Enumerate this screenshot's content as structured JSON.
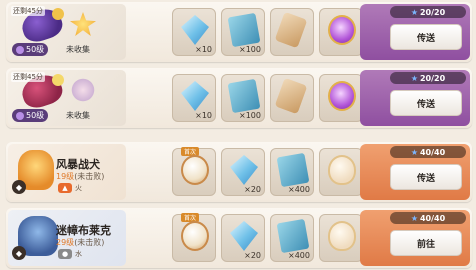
{
  "rows": [
    {
      "timer": "还剩45分",
      "level": "50级",
      "status": "未收集",
      "items": [
        {
          "icon": "diamond-icon",
          "qty": "×10"
        },
        {
          "icon": "book-icon",
          "qty": "×100"
        },
        {
          "icon": "scroll-icon",
          "qty": ""
        },
        {
          "icon": "purple-orb-icon",
          "qty": ""
        }
      ],
      "progress": "20/20",
      "action": "传送"
    },
    {
      "timer": "还剩45分",
      "level": "50级",
      "status": "未收集",
      "items": [
        {
          "icon": "diamond-icon",
          "qty": "×10"
        },
        {
          "icon": "book-icon",
          "qty": "×100"
        },
        {
          "icon": "scroll-icon",
          "qty": ""
        },
        {
          "icon": "purple-orb-icon",
          "qty": ""
        }
      ],
      "progress": "20/20",
      "action": "传送"
    },
    {
      "name": "风暴战犬",
      "level_num": "19级",
      "level_note": "(未击败)",
      "element": "火",
      "items": [
        {
          "icon": "stone-icon",
          "qty": "",
          "badge": "首次"
        },
        {
          "icon": "diamond-icon",
          "qty": "×20"
        },
        {
          "icon": "book-icon",
          "qty": "×400"
        },
        {
          "icon": "egg-icon",
          "qty": ""
        }
      ],
      "progress": "40/40",
      "action": "传送"
    },
    {
      "name": "迷幛布莱克",
      "level_num": "29级",
      "level_note": "(未击败)",
      "element": "水",
      "items": [
        {
          "icon": "stone-icon",
          "qty": "",
          "badge": "首次"
        },
        {
          "icon": "diamond-icon",
          "qty": "×20"
        },
        {
          "icon": "book-icon",
          "qty": "×400"
        },
        {
          "icon": "egg-icon",
          "qty": ""
        }
      ],
      "progress": "40/40",
      "action": "前往"
    }
  ]
}
